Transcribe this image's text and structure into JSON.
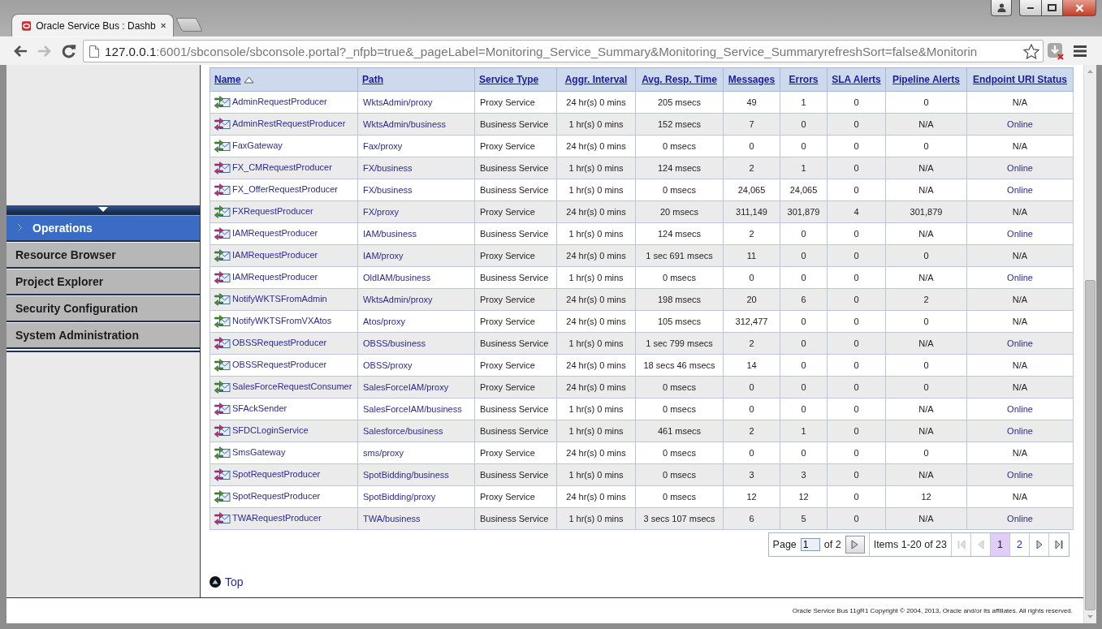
{
  "browser": {
    "tab_title": "Oracle Service Bus : Dashb",
    "back": {
      "disabled": false
    },
    "forward": {
      "disabled": true
    },
    "url_host": "127.0.0.1",
    "url_rest": ":6001/sbconsole/sbconsole.portal?_nfpb=true&_pageLabel=Monitoring_Service_Summary&Monitoring_Service_SummaryrefreshSort=false&Monitorin"
  },
  "sidebar": {
    "items": [
      {
        "label": "Operations",
        "selected": true
      },
      {
        "label": "Resource Browser",
        "selected": false
      },
      {
        "label": "Project Explorer",
        "selected": false
      },
      {
        "label": "Security Configuration",
        "selected": false
      },
      {
        "label": "System Administration",
        "selected": false
      }
    ]
  },
  "table": {
    "columns": [
      {
        "label": "Name",
        "sorted": true
      },
      {
        "label": "Path",
        "sorted": false
      },
      {
        "label": "Service Type",
        "sorted": false
      },
      {
        "label": "Aggr. Interval",
        "sorted": false
      },
      {
        "label": "Avg. Resp. Time",
        "sorted": false
      },
      {
        "label": "Messages",
        "sorted": false
      },
      {
        "label": "Errors",
        "sorted": false
      },
      {
        "label": "SLA Alerts",
        "sorted": false
      },
      {
        "label": "Pipeline Alerts",
        "sorted": false
      },
      {
        "label": "Endpoint URI Status",
        "sorted": false
      }
    ],
    "rows": [
      {
        "kind": "proxy",
        "name": "AdminRequestProducer",
        "path": "WktsAdmin/proxy",
        "service_type": "Proxy Service",
        "aggr_interval": "24 hr(s) 0 mins",
        "avg_resp_time": "205 msecs",
        "messages": "49",
        "errors": "1",
        "sla_alerts": "0",
        "pipeline_alerts": "0",
        "endpoint_uri_status": "N/A",
        "status_link": false
      },
      {
        "kind": "business",
        "name": "AdminRestRequestProducer",
        "path": "WktsAdmin/business",
        "service_type": "Business Service",
        "aggr_interval": "1 hr(s) 0 mins",
        "avg_resp_time": "152 msecs",
        "messages": "7",
        "errors": "0",
        "sla_alerts": "0",
        "pipeline_alerts": "N/A",
        "endpoint_uri_status": "Online",
        "status_link": true
      },
      {
        "kind": "proxy",
        "name": "FaxGateway",
        "path": "Fax/proxy",
        "service_type": "Proxy Service",
        "aggr_interval": "24 hr(s) 0 mins",
        "avg_resp_time": "0 msecs",
        "messages": "0",
        "errors": "0",
        "sla_alerts": "0",
        "pipeline_alerts": "0",
        "endpoint_uri_status": "N/A",
        "status_link": false
      },
      {
        "kind": "business",
        "name": "FX_CMRequestProducer",
        "path": "FX/business",
        "service_type": "Business Service",
        "aggr_interval": "1 hr(s) 0 mins",
        "avg_resp_time": "124 msecs",
        "messages": "2",
        "errors": "1",
        "sla_alerts": "0",
        "pipeline_alerts": "N/A",
        "endpoint_uri_status": "Online",
        "status_link": true
      },
      {
        "kind": "business",
        "name": "FX_OfferRequestProducer",
        "path": "FX/business",
        "service_type": "Business Service",
        "aggr_interval": "1 hr(s) 0 mins",
        "avg_resp_time": "0 msecs",
        "messages": "24,065",
        "errors": "24,065",
        "sla_alerts": "0",
        "pipeline_alerts": "N/A",
        "endpoint_uri_status": "Online",
        "status_link": true
      },
      {
        "kind": "proxy",
        "name": "FXRequestProducer",
        "path": "FX/proxy",
        "service_type": "Proxy Service",
        "aggr_interval": "24 hr(s) 0 mins",
        "avg_resp_time": "20 msecs",
        "messages": "311,149",
        "errors": "301,879",
        "sla_alerts": "4",
        "pipeline_alerts": "301,879",
        "endpoint_uri_status": "N/A",
        "status_link": false
      },
      {
        "kind": "business",
        "name": "IAMRequestProducer",
        "path": "IAM/business",
        "service_type": "Business Service",
        "aggr_interval": "1 hr(s) 0 mins",
        "avg_resp_time": "124 msecs",
        "messages": "2",
        "errors": "0",
        "sla_alerts": "0",
        "pipeline_alerts": "N/A",
        "endpoint_uri_status": "Online",
        "status_link": true
      },
      {
        "kind": "proxy",
        "name": "IAMRequestProducer",
        "path": "IAM/proxy",
        "service_type": "Proxy Service",
        "aggr_interval": "24 hr(s) 0 mins",
        "avg_resp_time": "1 sec 691 msecs",
        "messages": "11",
        "errors": "0",
        "sla_alerts": "0",
        "pipeline_alerts": "0",
        "endpoint_uri_status": "N/A",
        "status_link": false
      },
      {
        "kind": "business",
        "name": "IAMRequestProducer",
        "path": "OldIAM/business",
        "service_type": "Business Service",
        "aggr_interval": "1 hr(s) 0 mins",
        "avg_resp_time": "0 msecs",
        "messages": "0",
        "errors": "0",
        "sla_alerts": "0",
        "pipeline_alerts": "N/A",
        "endpoint_uri_status": "Online",
        "status_link": true
      },
      {
        "kind": "proxy",
        "name": "NotifyWKTSFromAdmin",
        "path": "WktsAdmin/proxy",
        "service_type": "Proxy Service",
        "aggr_interval": "24 hr(s) 0 mins",
        "avg_resp_time": "198 msecs",
        "messages": "20",
        "errors": "6",
        "sla_alerts": "0",
        "pipeline_alerts": "2",
        "endpoint_uri_status": "N/A",
        "status_link": false
      },
      {
        "kind": "proxy",
        "name": "NotifyWKTSFromVXAtos",
        "path": "Atos/proxy",
        "service_type": "Proxy Service",
        "aggr_interval": "24 hr(s) 0 mins",
        "avg_resp_time": "105 msecs",
        "messages": "312,477",
        "errors": "0",
        "sla_alerts": "0",
        "pipeline_alerts": "0",
        "endpoint_uri_status": "N/A",
        "status_link": false
      },
      {
        "kind": "business",
        "name": "OBSSRequestProducer",
        "path": "OBSS/business",
        "service_type": "Business Service",
        "aggr_interval": "1 hr(s) 0 mins",
        "avg_resp_time": "1 sec 799 msecs",
        "messages": "2",
        "errors": "0",
        "sla_alerts": "0",
        "pipeline_alerts": "N/A",
        "endpoint_uri_status": "Online",
        "status_link": true
      },
      {
        "kind": "proxy",
        "name": "OBSSRequestProducer",
        "path": "OBSS/proxy",
        "service_type": "Proxy Service",
        "aggr_interval": "24 hr(s) 0 mins",
        "avg_resp_time": "18 secs 46 msecs",
        "messages": "14",
        "errors": "0",
        "sla_alerts": "0",
        "pipeline_alerts": "0",
        "endpoint_uri_status": "N/A",
        "status_link": false
      },
      {
        "kind": "proxy",
        "name": "SalesForceRequestConsumer",
        "path": "SalesForceIAM/proxy",
        "service_type": "Proxy Service",
        "aggr_interval": "24 hr(s) 0 mins",
        "avg_resp_time": "0 msecs",
        "messages": "0",
        "errors": "0",
        "sla_alerts": "0",
        "pipeline_alerts": "0",
        "endpoint_uri_status": "N/A",
        "status_link": false
      },
      {
        "kind": "business",
        "name": "SFAckSender",
        "path": "SalesForceIAM/business",
        "service_type": "Business Service",
        "aggr_interval": "1 hr(s) 0 mins",
        "avg_resp_time": "0 msecs",
        "messages": "0",
        "errors": "0",
        "sla_alerts": "0",
        "pipeline_alerts": "N/A",
        "endpoint_uri_status": "Online",
        "status_link": true
      },
      {
        "kind": "business",
        "name": "SFDCLoginService",
        "path": "Salesforce/business",
        "service_type": "Business Service",
        "aggr_interval": "1 hr(s) 0 mins",
        "avg_resp_time": "461 msecs",
        "messages": "2",
        "errors": "1",
        "sla_alerts": "0",
        "pipeline_alerts": "N/A",
        "endpoint_uri_status": "Online",
        "status_link": true
      },
      {
        "kind": "proxy",
        "name": "SmsGateway",
        "path": "sms/proxy",
        "service_type": "Proxy Service",
        "aggr_interval": "24 hr(s) 0 mins",
        "avg_resp_time": "0 msecs",
        "messages": "0",
        "errors": "0",
        "sla_alerts": "0",
        "pipeline_alerts": "0",
        "endpoint_uri_status": "N/A",
        "status_link": false
      },
      {
        "kind": "business",
        "name": "SpotRequestProducer",
        "path": "SpotBidding/business",
        "service_type": "Business Service",
        "aggr_interval": "1 hr(s) 0 mins",
        "avg_resp_time": "0 msecs",
        "messages": "3",
        "errors": "3",
        "sla_alerts": "0",
        "pipeline_alerts": "N/A",
        "endpoint_uri_status": "Online",
        "status_link": true
      },
      {
        "kind": "proxy",
        "name": "SpotRequestProducer",
        "path": "SpotBidding/proxy",
        "service_type": "Proxy Service",
        "aggr_interval": "24 hr(s) 0 mins",
        "avg_resp_time": "0 msecs",
        "messages": "12",
        "errors": "12",
        "sla_alerts": "0",
        "pipeline_alerts": "12",
        "endpoint_uri_status": "N/A",
        "status_link": false
      },
      {
        "kind": "business",
        "name": "TWARequestProducer",
        "path": "TWA/business",
        "service_type": "Business Service",
        "aggr_interval": "1 hr(s) 0 mins",
        "avg_resp_time": "3 secs 107 msecs",
        "messages": "6",
        "errors": "5",
        "sla_alerts": "0",
        "pipeline_alerts": "N/A",
        "endpoint_uri_status": "Online",
        "status_link": true
      }
    ]
  },
  "pagination": {
    "page_label": "Page",
    "page_value": "1",
    "page_count": "of 2",
    "items": "Items 1-20 of 23",
    "first_button": {
      "disabled": true
    },
    "prev_button": {
      "disabled": true
    },
    "pages": [
      {
        "label": "1",
        "selected": true
      },
      {
        "label": "2",
        "selected": false
      }
    ],
    "next_button": {
      "disabled": false
    },
    "last_button": {
      "disabled": false
    }
  },
  "top_link": "Top",
  "footer": "Oracle Service Bus 11gR1 Copyright © 2004, 2013, Oracle and/or its affiliates. All rights reserved."
}
